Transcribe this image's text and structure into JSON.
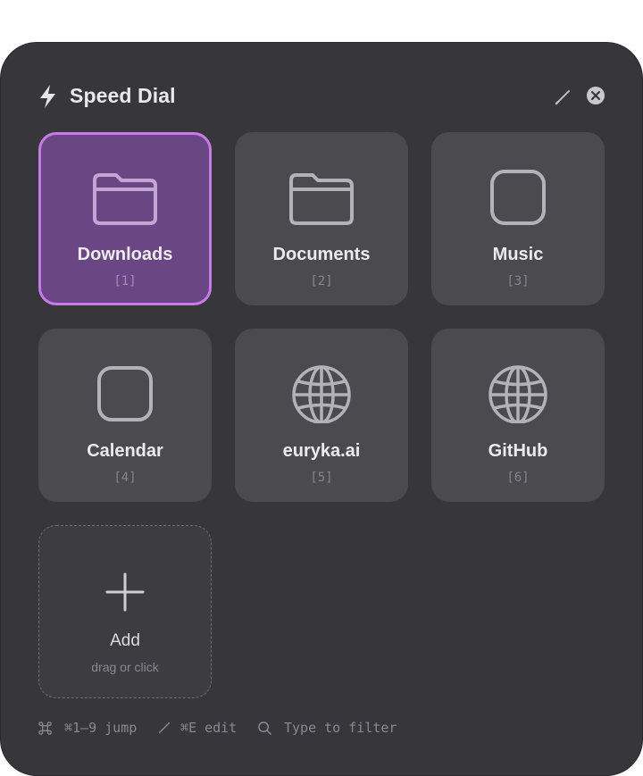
{
  "header": {
    "title": "Speed Dial",
    "icons": {
      "title": "lightning-bolt-icon",
      "edit": "pencil-icon",
      "close": "close-circle-icon"
    }
  },
  "tiles": [
    {
      "name": "Downloads",
      "key": "[1]",
      "icon": "folder-icon",
      "selected": true
    },
    {
      "name": "Documents",
      "key": "[2]",
      "icon": "folder-icon",
      "selected": false
    },
    {
      "name": "Music",
      "key": "[3]",
      "icon": "rounded-square-icon",
      "selected": false
    },
    {
      "name": "Calendar",
      "key": "[4]",
      "icon": "rounded-square-icon",
      "selected": false
    },
    {
      "name": "euryka.ai",
      "key": "[5]",
      "icon": "globe-icon",
      "selected": false
    },
    {
      "name": "GitHub",
      "key": "[6]",
      "icon": "globe-icon",
      "selected": false
    }
  ],
  "add_tile": {
    "label": "Add",
    "hint": "drag or click",
    "icon": "plus-icon"
  },
  "footer": {
    "jump": "⌘1–9 jump",
    "edit": "⌘E edit",
    "filter": "Type to filter",
    "icons": [
      "command-icon",
      "pencil-icon",
      "search-icon"
    ]
  },
  "colors": {
    "panel": "#37363b",
    "tile": "#4a4a4f",
    "selected_tile": "#6b4685",
    "selected_border": "#c77ae8"
  }
}
